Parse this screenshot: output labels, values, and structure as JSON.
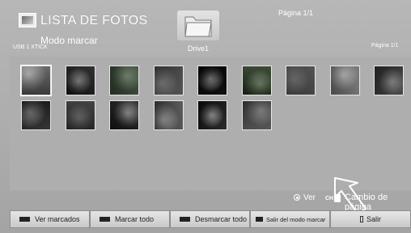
{
  "header": {
    "app_title": "LISTA DE FOTOS",
    "mode": "Modo marcar",
    "device": "USB 1 XTICK",
    "folder_label": "Drive1",
    "page_indicator": "Página 1/1",
    "page_indicator_small": "Página 1/1"
  },
  "thumbnails": [
    {
      "name": "thumb-1",
      "colors": [
        "#7a7a7a",
        "#dcdcdc"
      ],
      "selected": true
    },
    {
      "name": "thumb-2",
      "colors": [
        "#3a3a3a",
        "#e0e0e0"
      ]
    },
    {
      "name": "thumb-3",
      "colors": [
        "#5c6b5c",
        "#b9c4b4"
      ]
    },
    {
      "name": "thumb-4",
      "colors": [
        "#6f6f6f",
        "#c2c2c2"
      ]
    },
    {
      "name": "thumb-5",
      "colors": [
        "#111111",
        "#f0f0f0"
      ]
    },
    {
      "name": "thumb-6",
      "colors": [
        "#4d5a48",
        "#cdd7c6"
      ]
    },
    {
      "name": "thumb-7",
      "colors": [
        "#777777",
        "#b3b3b3"
      ]
    },
    {
      "name": "thumb-8",
      "colors": [
        "#8a8a8a",
        "#e4e4e4"
      ]
    },
    {
      "name": "thumb-9",
      "colors": [
        "#5a5a5a",
        "#cacaca"
      ]
    },
    {
      "name": "thumb-10",
      "colors": [
        "#414141",
        "#dadada"
      ]
    },
    {
      "name": "thumb-11",
      "colors": [
        "#5e5e5e",
        "#b8b8b8"
      ]
    },
    {
      "name": "thumb-12",
      "colors": [
        "#3c3c3c",
        "#d8d8d8"
      ]
    },
    {
      "name": "thumb-13",
      "colors": [
        "#666666",
        "#e8e8e8"
      ]
    },
    {
      "name": "thumb-14",
      "colors": [
        "#2f2f2f",
        "#efefef"
      ]
    },
    {
      "name": "thumb-15",
      "colors": [
        "#6c6c6c",
        "#d0d0d0"
      ]
    }
  ],
  "hints": {
    "ver": "Ver",
    "ch_badge": "CH",
    "page_change": "Cambio de página"
  },
  "buttons": {
    "ver_marcados": "Ver marcados",
    "marcar_todo": "Marcar todo",
    "desmarcar_todo": "Desmarcar todo",
    "salir_modo_marcar": "Salir del modo marcar",
    "salir": "Salir"
  },
  "colors": {
    "background": "#a9a9a9",
    "panel": "#aeaeae",
    "text": "#ffffff"
  }
}
